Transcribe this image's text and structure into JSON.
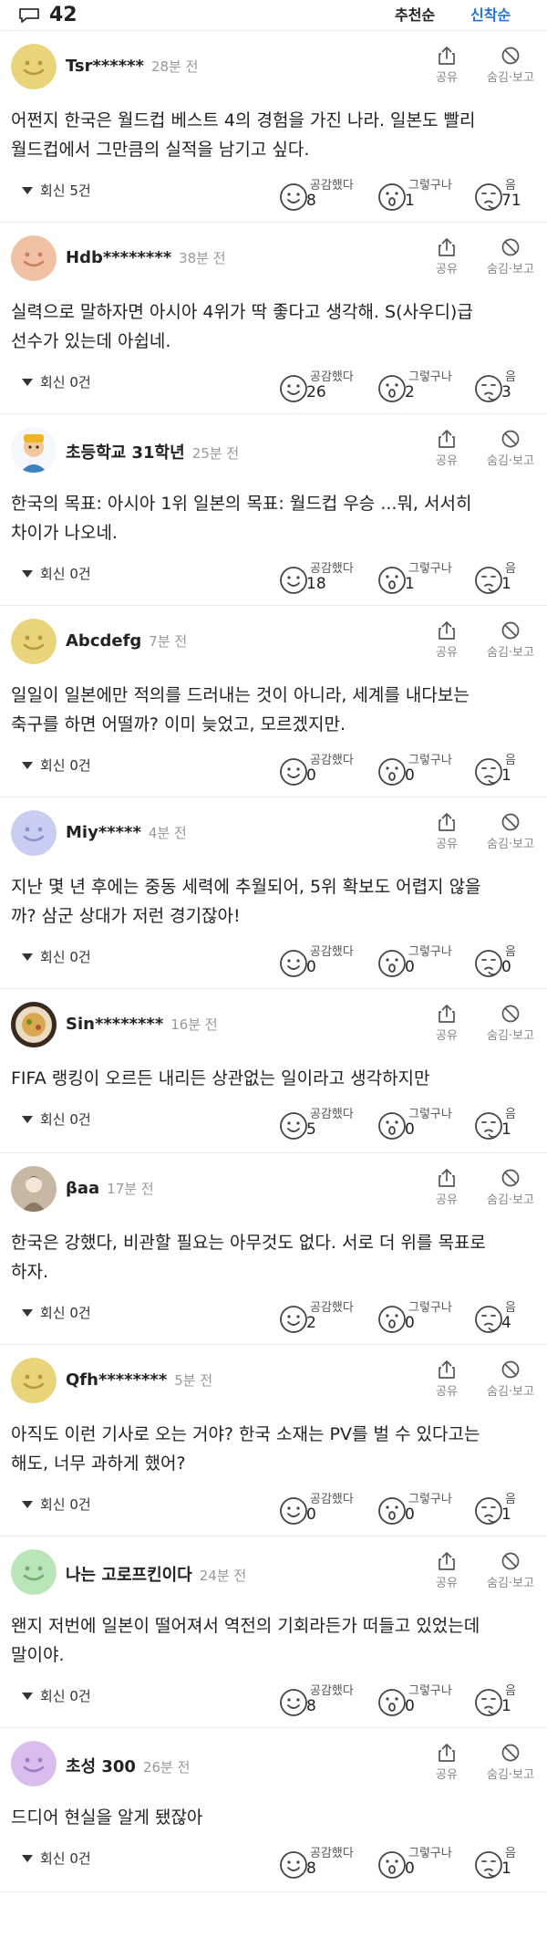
{
  "header": {
    "comment_count": "42",
    "sort_recommended": "추천순",
    "sort_newest": "신착순"
  },
  "labels": {
    "share": "공유",
    "hide_report": "숨김·보고",
    "empathy": "공감했다",
    "i_see": "그렇구나",
    "hmm": "음"
  },
  "colors": {
    "accent": "#1f74d6",
    "divider": "#ececec"
  },
  "comments": [
    {
      "avatar": "smiley-yellow",
      "author": "Tsr******",
      "time": "28분 전",
      "lines": [
        "어쩐지 한국은 월드컵 베스트 4의 경험을 가진 나라. 일본도 빨리",
        "월드컵에서 그만큼의 실적을 남기고 싶다."
      ],
      "replies": "회신 5건",
      "empathy": "8",
      "i_see": "1",
      "hmm": "71"
    },
    {
      "avatar": "smiley-peach",
      "author": "Hdb********",
      "time": "38분 전",
      "lines": [
        "실력으로 말하자면 아시아 4위가 딱 좋다고 생각해. S(사우디)급",
        "선수가 있는데 아쉽네."
      ],
      "replies": "회신 0건",
      "empathy": "26",
      "i_see": "2",
      "hmm": "3"
    },
    {
      "avatar": "photo-cartoon",
      "author": "초등학교 31학년",
      "time": "25분 전",
      "lines": [
        "한국의 목표: 아시아 1위 일본의 목표: 월드컵 우승 ...뭐, 서서히",
        "차이가 나오네."
      ],
      "replies": "회신 0건",
      "empathy": "18",
      "i_see": "1",
      "hmm": "1"
    },
    {
      "avatar": "smiley-yellow",
      "author": "Abcdefg",
      "time": "7분 전",
      "lines": [
        "일일이 일본에만 적의를 드러내는 것이 아니라, 세계를 내다보는",
        "축구를 하면 어떨까? 이미 늦었고, 모르겠지만."
      ],
      "replies": "회신 0건",
      "empathy": "0",
      "i_see": "0",
      "hmm": "1"
    },
    {
      "avatar": "smiley-lavender",
      "author": "Miy*****",
      "time": "4분 전",
      "lines": [
        "지난 몇 년 후에는 중동 세력에 추월되어, 5위 확보도 어렵지 않을",
        "까? 삼군 상대가 저런 경기잖아!"
      ],
      "replies": "회신 0건",
      "empathy": "0",
      "i_see": "0",
      "hmm": "0"
    },
    {
      "avatar": "photo-food",
      "author": "Sin********",
      "time": "16분 전",
      "lines": [
        "FIFA 랭킹이 오르든 내리든 상관없는 일이라고 생각하지만"
      ],
      "replies": "회신 0건",
      "empathy": "5",
      "i_see": "0",
      "hmm": "1"
    },
    {
      "avatar": "photo-person",
      "author": "βaa",
      "time": "17분 전",
      "lines": [
        "한국은 강했다, 비관할 필요는 아무것도 없다. 서로 더 위를 목표로",
        "하자."
      ],
      "replies": "회신 0건",
      "empathy": "2",
      "i_see": "0",
      "hmm": "4"
    },
    {
      "avatar": "smiley-yellow",
      "author": "Qfh********",
      "time": "5분 전",
      "lines": [
        "아직도 이런 기사로 오는 거야? 한국 소재는 PV를 벌 수 있다고는",
        "해도, 너무 과하게 했어?"
      ],
      "replies": "회신 0건",
      "empathy": "0",
      "i_see": "0",
      "hmm": "1"
    },
    {
      "avatar": "smiley-mint",
      "author": "나는 고로프킨이다",
      "time": "24분 전",
      "lines": [
        "왠지 저번에 일본이 떨어져서 역전의 기회라든가 떠들고 있었는데",
        "말이야."
      ],
      "replies": "회신 0건",
      "empathy": "8",
      "i_see": "0",
      "hmm": "1"
    },
    {
      "avatar": "smiley-violet",
      "author": "초성 300",
      "time": "26분 전",
      "lines": [
        "드디어 현실을 알게 됐잖아"
      ],
      "replies": "회신 0건",
      "empathy": "8",
      "i_see": "0",
      "hmm": "1"
    }
  ]
}
